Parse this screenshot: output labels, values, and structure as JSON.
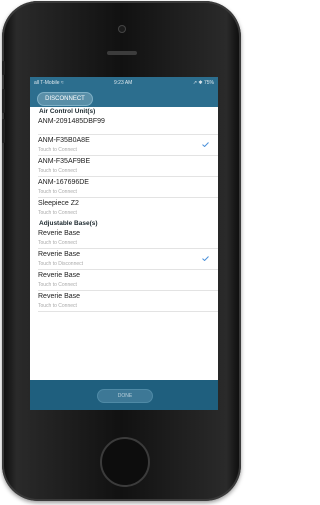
{
  "status_bar": {
    "carrier": "all T-Mobile ≈",
    "time": "9:23 AM",
    "right": "↗ ✱ 75%"
  },
  "header": {
    "disconnect_label": "DISCONNECT"
  },
  "sections": [
    {
      "title": "Air Control Unit(s)",
      "items": [
        {
          "name": "ANM-2091485DBF99",
          "subtitle": "",
          "checked": false
        },
        {
          "name": "ANM-F35B0A8E",
          "subtitle": "Touch to Connect",
          "checked": true
        },
        {
          "name": "ANM-F35AF9BE",
          "subtitle": "Touch to Connect",
          "checked": false
        },
        {
          "name": "ANM-167696DE",
          "subtitle": "Touch to Connect",
          "checked": false
        },
        {
          "name": "Sleepiece Z2",
          "subtitle": "Touch to Connect",
          "checked": false
        }
      ]
    },
    {
      "title": "Adjustable Base(s)",
      "items": [
        {
          "name": "Reverie Base",
          "subtitle": "Touch to Connect",
          "checked": false
        },
        {
          "name": "Reverie Base",
          "subtitle": "Touch to Disconnect",
          "checked": true
        },
        {
          "name": "Reverie Base",
          "subtitle": "Touch to Connect",
          "checked": false
        },
        {
          "name": "Reverie Base",
          "subtitle": "Touch to Connect",
          "checked": false
        }
      ]
    }
  ],
  "footer": {
    "done_label": "DONE"
  },
  "colors": {
    "header_bg": "#2c6e8e",
    "footer_bg": "#1f5f7e",
    "check": "#4a90d9"
  }
}
